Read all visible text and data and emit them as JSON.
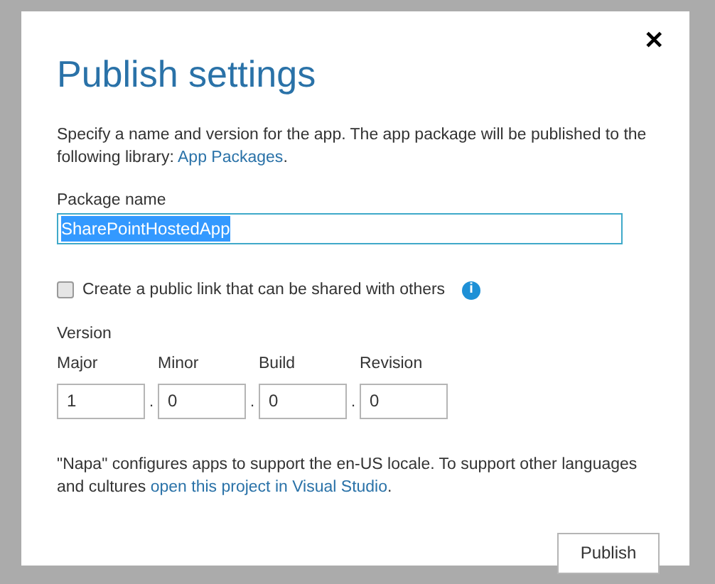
{
  "dialog": {
    "title": "Publish settings",
    "close": "✕"
  },
  "description": {
    "text": "Specify a name and version for the app. The app package will be published to the following library: ",
    "link": "App Packages",
    "after": "."
  },
  "package_name": {
    "label": "Package name",
    "value": "SharePointHostedApp",
    "selected": true
  },
  "public_link": {
    "label": "Create a public link that can be shared with others",
    "checked": false,
    "info": "i"
  },
  "version": {
    "label": "Version",
    "fields": [
      {
        "label": "Major",
        "value": "1"
      },
      {
        "label": "Minor",
        "value": "0"
      },
      {
        "label": "Build",
        "value": "0"
      },
      {
        "label": "Revision",
        "value": "0"
      }
    ],
    "separator": "."
  },
  "note": {
    "text": "\"Napa\" configures apps to support the en-US locale. To support other languages and cultures ",
    "link": "open this project in Visual Studio",
    "after": "."
  },
  "buttons": [
    "Publish"
  ]
}
